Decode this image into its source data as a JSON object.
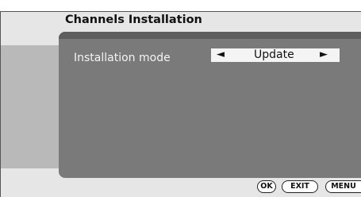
{
  "header": {
    "title": "Channels Installation"
  },
  "settings": {
    "installation_mode": {
      "label": "Installation mode",
      "value": "Update",
      "arrow_left": "◄",
      "arrow_right": "►"
    }
  },
  "footer": {
    "ok": "OK",
    "exit": "EXIT",
    "menu": "MENU"
  }
}
